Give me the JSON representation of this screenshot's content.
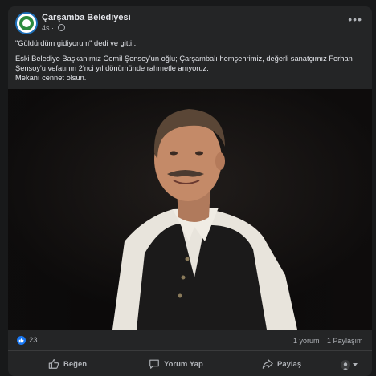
{
  "post": {
    "page_name": "Çarşamba Belediyesi",
    "time": "4s",
    "more_label": "•••",
    "paragraphs": [
      "\"Güldürdüm gidiyorum\" dedi ve gitti..",
      "Eski Belediye Başkanımız Cemil Şensoy'un oğlu; Çarşambalı hemşehrimiz, değerli sanatçımız Ferhan Şensoy'u vefatının 2'nci yıl dönümünde rahmetle anıyoruz.",
      "Mekanı cennet olsun."
    ]
  },
  "stats": {
    "reactions": "23",
    "comments": "1 yorum",
    "shares": "1 Paylaşım"
  },
  "actions": {
    "like": "Beğen",
    "comment": "Yorum Yap",
    "share": "Paylaş"
  },
  "colors": {
    "background": "#18191a",
    "card": "#242526",
    "text": "#e4e6eb",
    "muted": "#b0b3b8",
    "like_blue": "#1877f2"
  },
  "icons": [
    "globe-icon",
    "more-icon",
    "like-reaction-icon",
    "thumbs-up-icon",
    "comment-icon",
    "share-icon",
    "audience-selector-icon"
  ]
}
